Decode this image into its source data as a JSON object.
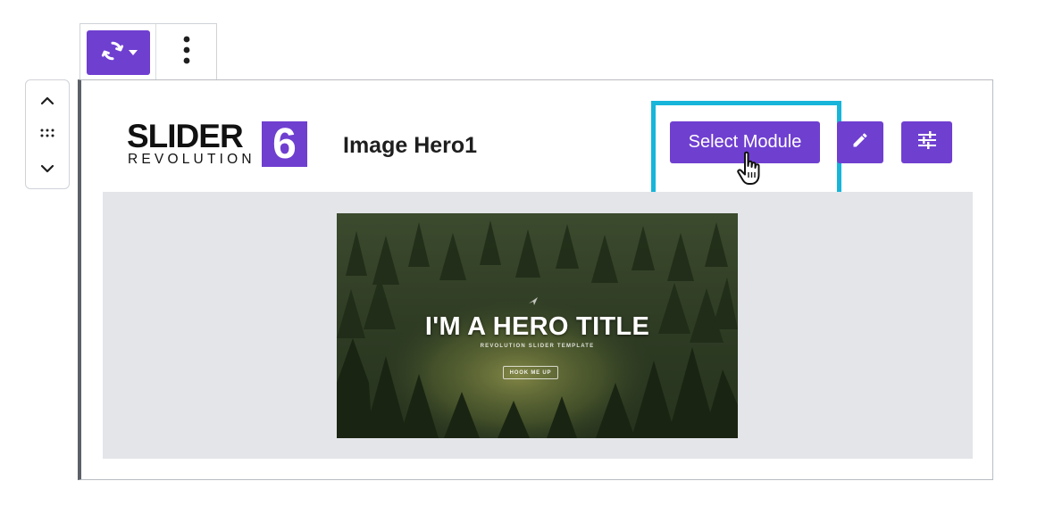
{
  "toolbar": {
    "transform_icon": "rotate-arrows-icon",
    "dropdown_icon": "caret-down-icon",
    "more_icon": "vertical-ellipsis-icon"
  },
  "mover": {
    "up_icon": "chevron-up-icon",
    "drag_icon": "drag-handle-icon",
    "down_icon": "chevron-down-icon"
  },
  "block": {
    "logo": {
      "word": "SLIDER",
      "subword": "REVOLUTION",
      "number": "6"
    },
    "module_title": "Image Hero1",
    "select_module_label": "Select Module",
    "edit_icon": "pencil-icon",
    "settings_icon": "sliders-icon",
    "cursor_icon": "hand-pointer-icon",
    "preview": {
      "hero_title": "I'M A HERO TITLE",
      "hero_subtitle": "REVOLUTION SLIDER TEMPLATE",
      "hero_button": "HOOK ME UP"
    }
  },
  "colors": {
    "accent": "#6f3fd0",
    "highlight": "#17b5d9",
    "preview_bg": "#e3e5e9",
    "border_left": "#5c6068"
  }
}
